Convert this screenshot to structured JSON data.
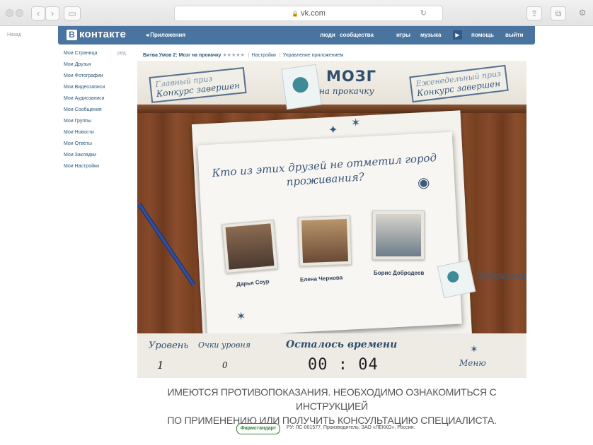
{
  "browser": {
    "url": "vk.com",
    "lock_icon": "lock-icon"
  },
  "vk": {
    "back_label": "Назад",
    "logo": "B",
    "logo_text": "контакте",
    "apps_label": "◂ Приложения",
    "nav": [
      "люди",
      "сообщества",
      "игры",
      "музыка",
      "помощь",
      "выйти"
    ],
    "sidebar": [
      "Мои Страница",
      "Мои Друзья",
      "Мои Фотографии",
      "Мои Видеозаписи",
      "Мои Аудиозаписи",
      "Мои Сообщения",
      "Мои Группы",
      "Мои Новости",
      "Мои Ответы",
      "Мои Закладки",
      "Мои Настройки"
    ],
    "edit_label": "ред.",
    "app_title": "Битва Умов 2: Мозг на прокачку",
    "app_stars": "★★★★★",
    "settings_link": "Настройки",
    "manage_link": "Управление приложением"
  },
  "game": {
    "stamp_left": "Конкурс завершен",
    "stamp_left_bg": "Главный приз",
    "stamp_right": "Конкурс завершен",
    "stamp_right_bg": "Еженедельный приз",
    "brain_title": "МОЗГ",
    "brain_subtitle": "на прокачку",
    "question": "Кто из этих друзей не отметил город проживания?",
    "friends": [
      {
        "name": "Дарья Соур"
      },
      {
        "name": "Елена Чернова"
      },
      {
        "name": "Борис Добродеев"
      }
    ],
    "hint_label": "Подсказка",
    "level_label": "Уровень",
    "level_value": "1",
    "points_label": "Очки уровня",
    "points_value": "0",
    "time_label": "Осталось времени",
    "time_value": "00 : 04",
    "menu_label": "Меню"
  },
  "footer": {
    "warning_line1": "ИМЕЮТСЯ ПРОТИВОПОКАЗАНИЯ. НЕОБХОДИМО ОЗНАКОМИТЬСЯ С ИНСТРУКЦИЕЙ",
    "warning_line2": "ПО ПРИМЕНЕНИЮ ИЛИ ПОЛУЧИТЬ КОНСУЛЬТАЦИЮ СПЕЦИАЛИСТА.",
    "reg_logo": "Фармстандарт",
    "reg_text": "РУ: ЛС-001577. Производитель: ЗАО «ЛЕККО», Россия."
  }
}
